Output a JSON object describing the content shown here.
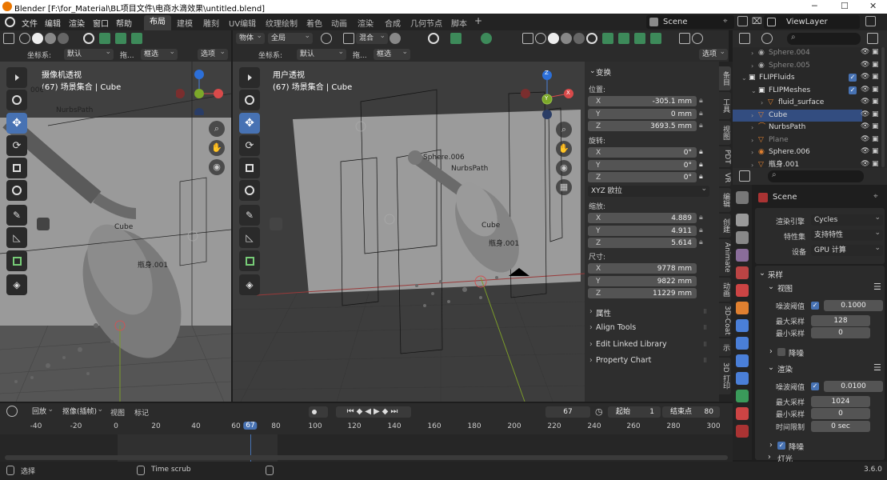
{
  "window": {
    "title": "Blender [F:\\for_Material\\BL项目文件\\电商水滴效果\\untitled.blend]",
    "minimize": "─",
    "maximize": "☐",
    "close": "✕"
  },
  "menu": {
    "file": "文件",
    "edit": "编辑",
    "render": "渲染",
    "window": "窗口",
    "help": "帮助"
  },
  "workspaces": [
    "布局",
    "建模",
    "雕刻",
    "UV编辑",
    "纹理绘制",
    "着色",
    "动画",
    "渲染",
    "合成",
    "几何节点",
    "脚本"
  ],
  "add_tab": "+",
  "scene_name": "Scene",
  "view_layer": "ViewLayer",
  "left_view": {
    "header": {
      "coords_label": "坐标系:",
      "coords_value": "默认",
      "drag": "拖...",
      "select": "框选",
      "options": "选项"
    },
    "title": "摄像机透视",
    "subtitle": "(67) 场景集合 | Cube",
    "labels": {
      "nurbs": "NurbsPath",
      "cube": "Cube",
      "bottle": "瓶身.001",
      "sphere": "006"
    }
  },
  "main_view": {
    "header": {
      "mode": "物体",
      "global": "全局",
      "mix": "混合",
      "coords_label": "坐标系:",
      "coords_value": "默认",
      "drag": "拖...",
      "select": "框选",
      "options": "选项"
    },
    "title": "用户透视",
    "subtitle": "(67) 场景集合 | Cube",
    "labels": {
      "sphere": "Sphere.006",
      "nurbs": "NurbsPath",
      "cube": "Cube",
      "bottle": "瓶身.001"
    },
    "gizmo": {
      "x": "X",
      "y": "Y",
      "z": "Z"
    }
  },
  "n_panel": {
    "transform": "变换",
    "location": "位置:",
    "loc": [
      {
        "axis": "X",
        "value": "-305.1 mm"
      },
      {
        "axis": "Y",
        "value": "0 mm"
      },
      {
        "axis": "Z",
        "value": "3693.5 mm"
      }
    ],
    "rotation": "旋转:",
    "rot": [
      {
        "axis": "X",
        "value": "0°"
      },
      {
        "axis": "Y",
        "value": "0°"
      },
      {
        "axis": "Z",
        "value": "0°"
      }
    ],
    "rot_mode": "XYZ 欧拉",
    "scale": "缩放:",
    "scl": [
      {
        "axis": "X",
        "value": "4.889"
      },
      {
        "axis": "Y",
        "value": "4.911"
      },
      {
        "axis": "Z",
        "value": "5.614"
      }
    ],
    "dimensions": "尺寸:",
    "dim": [
      {
        "axis": "X",
        "value": "9778 mm"
      },
      {
        "axis": "Y",
        "value": "9822 mm"
      },
      {
        "axis": "Z",
        "value": "11229 mm"
      }
    ],
    "sections": [
      "属性",
      "Align Tools",
      "Edit Linked Library",
      "Property Chart"
    ],
    "tabs": [
      "条目",
      "工具",
      "视图",
      "PDT",
      "VR",
      "编辑",
      "创建",
      "Animate",
      "动画",
      "3D-Coat",
      "示",
      "3D 打印"
    ]
  },
  "outliner": {
    "rows": [
      {
        "name": "Sphere.004",
        "indent": 2
      },
      {
        "name": "Sphere.005",
        "indent": 2
      },
      {
        "name": "FLIPFluids",
        "indent": 1
      },
      {
        "name": "FLIPMeshes",
        "indent": 2
      },
      {
        "name": "fluid_surface",
        "indent": 3
      },
      {
        "name": "Cube",
        "indent": 2
      },
      {
        "name": "NurbsPath",
        "indent": 2
      },
      {
        "name": "Plane",
        "indent": 2
      },
      {
        "name": "Sphere.006",
        "indent": 2
      },
      {
        "name": "瓶身.001",
        "indent": 2
      }
    ]
  },
  "properties": {
    "scene": "Scene",
    "render_engine_label": "渲染引擎",
    "render_engine": "Cycles",
    "feature_set_label": "特性集",
    "feature_set": "支持特性",
    "device_label": "设备",
    "device": "GPU 计算",
    "sampling": "采样",
    "viewport": "视图",
    "noise_threshold_label": "噪波阈值",
    "viewport_noise": "0.1000",
    "max_samples_label": "最大采样",
    "viewport_max": "128",
    "min_samples_label": "最小采样",
    "viewport_min": "0",
    "denoise": "降噪",
    "render": "渲染",
    "render_noise": "0.0100",
    "render_max": "1024",
    "render_min": "0",
    "time_limit_label": "时间限制",
    "time_limit": "0 sec",
    "denoise2": "降噪",
    "lights": "灯光"
  },
  "timeline": {
    "playback": "回放",
    "keying": "抠像(插帧)",
    "view": "视图",
    "marker": "标记",
    "current_frame": "67",
    "start_label": "起始",
    "start": "1",
    "end_label": "结束点",
    "end": "80",
    "ticks": [
      "-40",
      "-20",
      "0",
      "20",
      "40",
      "60",
      "67",
      "80",
      "100",
      "120",
      "140",
      "160",
      "180",
      "200",
      "220",
      "240",
      "260",
      "280",
      "300"
    ]
  },
  "status": {
    "select": "选择",
    "time_scrub": "Time scrub",
    "version": "3.6.0"
  }
}
